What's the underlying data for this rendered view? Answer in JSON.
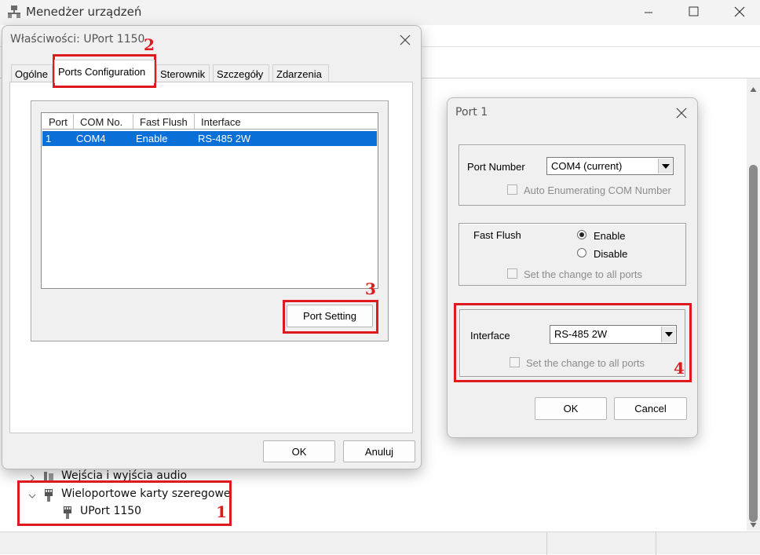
{
  "device_manager": {
    "title": "Menedżer urządzeń",
    "tree": {
      "audio_label": "Wejścia i wyjścia audio",
      "multiport_label": "Wieloportowe karty szeregowe",
      "uport_label": "UPort 1150"
    }
  },
  "properties_dialog": {
    "title": "Właściwości: UPort 1150",
    "tabs": [
      "Ogólne",
      "Ports Configuration",
      "Sterownik",
      "Szczegóły",
      "Zdarzenia"
    ],
    "active_tab": "Ports Configuration",
    "list": {
      "columns": [
        "Port",
        "COM No.",
        "Fast Flush",
        "Interface"
      ],
      "rows": [
        [
          "1",
          "COM4",
          "Enable",
          "RS-485 2W"
        ]
      ]
    },
    "port_setting_label": "Port Setting",
    "ok_label": "OK",
    "cancel_label": "Anuluj"
  },
  "port_dialog": {
    "title": "Port 1",
    "port_number_label": "Port Number",
    "port_number_value": "COM4 (current)",
    "auto_enumerating_label": "Auto Enumerating COM Number",
    "auto_enumerating_checked": false,
    "fast_flush_label": "Fast Flush",
    "fast_flush_enable_label": "Enable",
    "fast_flush_disable_label": "Disable",
    "fast_flush_selected": "Enable",
    "fast_flush_all_label": "Set the change to all ports",
    "interface_label": "Interface",
    "interface_value": "RS-485 2W",
    "interface_all_label": "Set the change to all ports",
    "ok_label": "OK",
    "cancel_label": "Cancel"
  },
  "annotations": {
    "step1": "1",
    "step2": "2",
    "step3": "3",
    "step4": "4",
    "color": "#e0191e"
  },
  "colors": {
    "selection": "#0a6fd6",
    "dialog_bg": "#f0f0f0"
  }
}
